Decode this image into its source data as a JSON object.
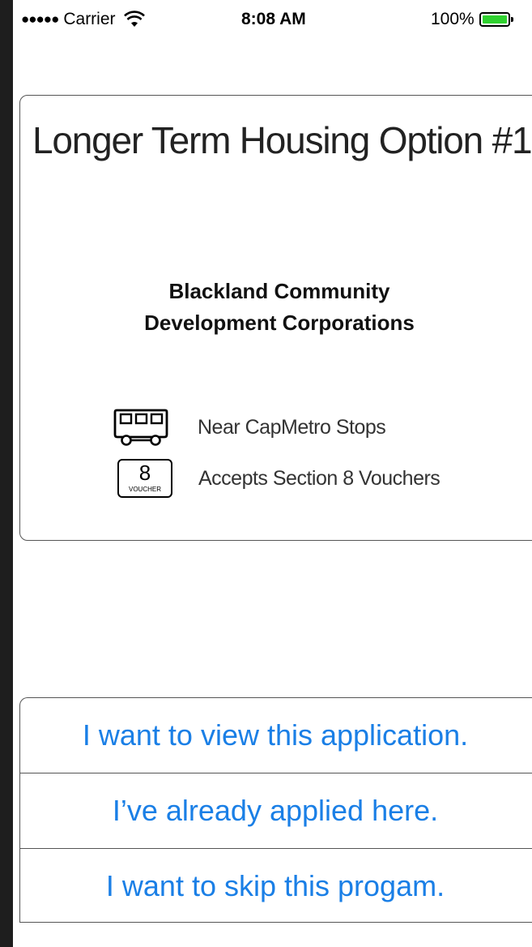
{
  "status_bar": {
    "signal": "●●●●●",
    "carrier": "Carrier",
    "time": "8:08 AM",
    "battery_percent": "100%",
    "battery_level": 1.0,
    "battery_color": "#2fd12f"
  },
  "card": {
    "title": "Longer Term Housing Option #1",
    "org_name_line1": "Blackland Community",
    "org_name_line2": "Development Corporations",
    "features": [
      {
        "icon": "bus-icon",
        "label": "Near CapMetro Stops"
      },
      {
        "icon": "voucher-icon",
        "label": "Accepts Section 8 Vouchers",
        "icon_number": "8",
        "icon_text": "VOUCHER"
      }
    ]
  },
  "actions": [
    {
      "label": "I want to view this application."
    },
    {
      "label": "I’ve already applied here."
    },
    {
      "label": "I want to skip this progam."
    }
  ],
  "colors": {
    "link": "#1a7fe6",
    "frame": "#1e1e1e"
  }
}
